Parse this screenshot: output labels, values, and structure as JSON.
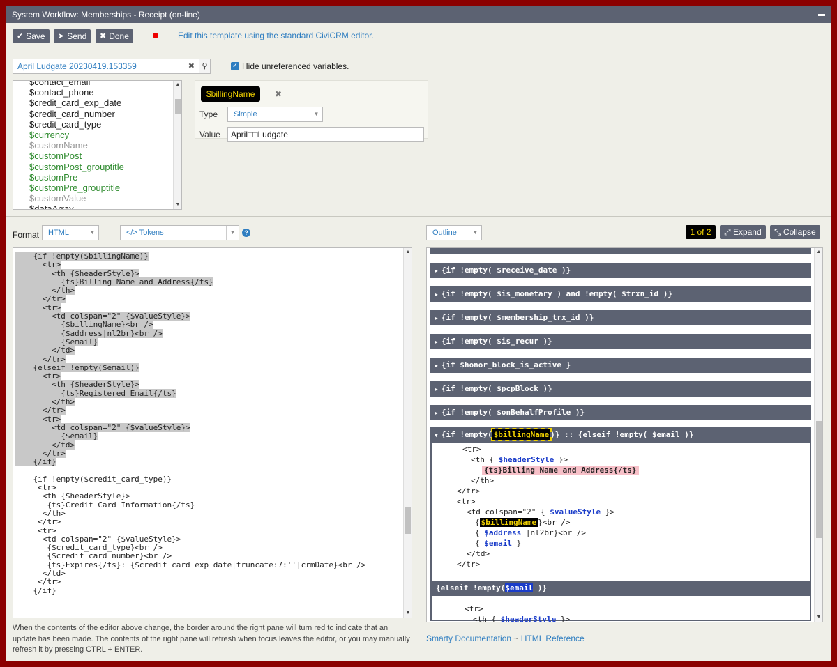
{
  "window": {
    "title": "System Workflow: Memberships - Receipt (on-line)"
  },
  "toolbar": {
    "save_label": "Save",
    "send_label": "Send",
    "done_label": "Done",
    "edit_link": "Edit this template using the standard CiviCRM editor."
  },
  "contact_search": {
    "value": "April Ludgate 20230419.153359"
  },
  "hide_unreferenced": {
    "label": "Hide unreferenced variables.",
    "checked": true
  },
  "variables": [
    {
      "name": "$contact_email",
      "status": "referenced"
    },
    {
      "name": "$contact_phone",
      "status": "referenced"
    },
    {
      "name": "$credit_card_exp_date",
      "status": "referenced"
    },
    {
      "name": "$credit_card_number",
      "status": "referenced"
    },
    {
      "name": "$credit_card_type",
      "status": "referenced"
    },
    {
      "name": "$currency",
      "status": "green"
    },
    {
      "name": "$customName",
      "status": "unset"
    },
    {
      "name": "$customPost",
      "status": "green"
    },
    {
      "name": "$customPost_grouptitle",
      "status": "green"
    },
    {
      "name": "$customPre",
      "status": "green"
    },
    {
      "name": "$customPre_grouptitle",
      "status": "green"
    },
    {
      "name": "$customValue",
      "status": "unset"
    },
    {
      "name": "$dataArray",
      "status": "referenced"
    }
  ],
  "selected_variable": {
    "name": "$billingName",
    "type_label": "Type",
    "type_value": "Simple",
    "value_label": "Value",
    "value": "April□□Ludgate"
  },
  "format": {
    "label": "Format",
    "value": "HTML",
    "tokens_label": "</> Tokens"
  },
  "editor": {
    "lines": [
      "    {if !empty($billingName)}",
      "      <tr>",
      "        <th {$headerStyle}>",
      "          {ts}Billing Name and Address{/ts}",
      "        </th>",
      "      </tr>",
      "      <tr>",
      "        <td colspan=\"2\" {$valueStyle}>",
      "          {$billingName}<br />",
      "          {$address|nl2br}<br />",
      "          {$email}",
      "        </td>",
      "      </tr>",
      "    {elseif !empty($email)}",
      "      <tr>",
      "        <th {$headerStyle}>",
      "          {ts}Registered Email{/ts}",
      "        </th>",
      "      </tr>",
      "      <tr>",
      "        <td colspan=\"2\" {$valueStyle}>",
      "          {$email}",
      "        </td>",
      "      </tr>",
      "    {/if}",
      "",
      "    {if !empty($credit_card_type)}",
      "     <tr>",
      "      <th {$headerStyle}>",
      "       {ts}Credit Card Information{/ts}",
      "      </th>",
      "     </tr>",
      "     <tr>",
      "      <td colspan=\"2\" {$valueStyle}>",
      "       {$credit_card_type}<br />",
      "       {$credit_card_number}<br />",
      "       {ts}Expires{/ts}: {$credit_card_exp_date|truncate:7:''|crmDate}<br />",
      "      </td>",
      "     </tr>",
      "    {/if}"
    ]
  },
  "help_text": "When the contents of the editor above change, the border around the right pane will turn red to indicate that an update has been made. The contents of the right pane will refresh when focus leaves the editor, or you may manually refresh it by pressing CTRL + ENTER.",
  "outline": {
    "mode": "Outline",
    "pager": "1 of 2",
    "expand_label": "Expand",
    "collapse_label": "Collapse",
    "sections": [
      "{if !empty( $receive_date )}",
      "{if !empty( $is_monetary ) and !empty( $trxn_id )}",
      "{if !empty( $membership_trx_id )}",
      "{if !empty( $is_recur )}",
      "{if $honor_block_is_active }",
      "{if !empty( $pcpBlock )}",
      "{if !empty( $onBehalfProfile )}"
    ],
    "expanded_head_pre": "{if !empty(",
    "expanded_head_var": "$billingName",
    "expanded_head_post": ")} :: {elseif !empty( $email )}",
    "elseif_head_pre": "{elseif !empty(",
    "elseif_head_var": "$email",
    "elseif_head_post": " )}"
  },
  "footer_links": {
    "smarty": "Smarty Documentation",
    "sep": "~",
    "html": "HTML Reference"
  }
}
